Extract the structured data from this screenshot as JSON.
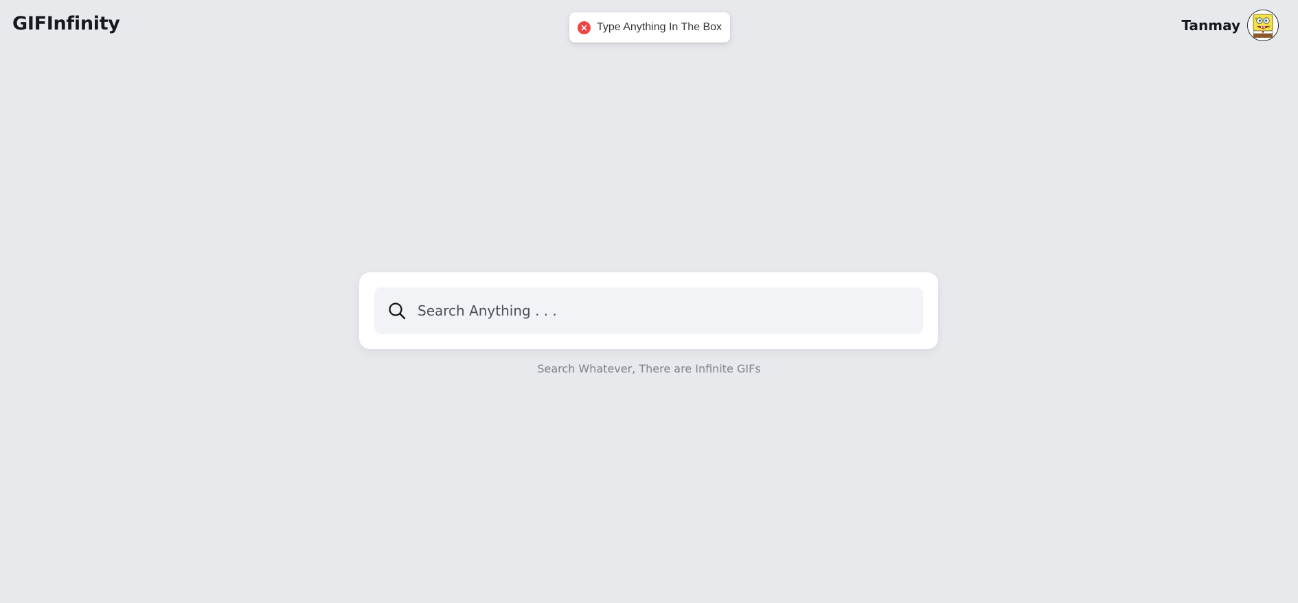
{
  "header": {
    "brand": "GIFInfinity",
    "user": {
      "name": "Tanmay",
      "avatar_icon": "spongebob-avatar-icon"
    }
  },
  "toast": {
    "icon": "error-x-icon",
    "message": "Type Anything In The Box",
    "color": "#ef4444"
  },
  "search": {
    "icon": "search-icon",
    "placeholder": "Search Anything . . .",
    "value": "",
    "hint": "Search Whatever, There are Infinite GIFs"
  },
  "colors": {
    "background": "#e8e9ed",
    "card": "#ffffff",
    "field": "#f2f3f7"
  }
}
